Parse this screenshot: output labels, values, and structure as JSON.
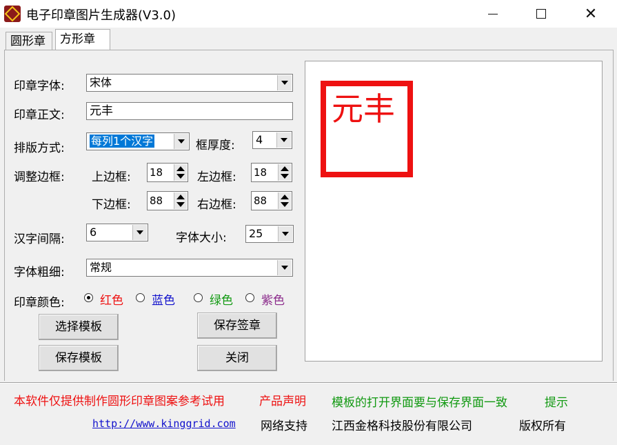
{
  "window": {
    "title": "电子印章图片生成器(V3.0)"
  },
  "tabs": [
    {
      "label": "圆形章"
    },
    {
      "label": "方形章"
    }
  ],
  "form": {
    "font_label": "印章字体:",
    "font_value": "宋体",
    "text_label": "印章正文:",
    "text_value": "元丰",
    "layout_label": "排版方式:",
    "layout_value": "每列1个汉字",
    "frame_thickness_label": "框厚度:",
    "frame_thickness_value": "4",
    "adjust_border_label": "调整边框:",
    "top_border_label": "上边框:",
    "top_border_value": "18",
    "left_border_label": "左边框:",
    "left_border_value": "18",
    "bottom_border_label": "下边框:",
    "bottom_border_value": "88",
    "right_border_label": "右边框:",
    "right_border_value": "88",
    "char_spacing_label": "汉字间隔:",
    "char_spacing_value": "6",
    "font_size_label": "字体大小:",
    "font_size_value": "25",
    "font_weight_label": "字体粗细:",
    "font_weight_value": "常规",
    "color_label": "印章颜色:",
    "colors": [
      {
        "label": "红色",
        "color": "#ee1111",
        "selected": true
      },
      {
        "label": "蓝色",
        "color": "#1111cc",
        "selected": false
      },
      {
        "label": "绿色",
        "color": "#119911",
        "selected": false
      },
      {
        "label": "紫色",
        "color": "#8b2b8b",
        "selected": false
      }
    ]
  },
  "buttons": {
    "select_template": "选择模板",
    "save_template": "保存模板",
    "save_seal": "保存签章",
    "close": "关闭"
  },
  "preview": {
    "stamp_text": "元丰",
    "stamp_color": "#ee1111"
  },
  "footer": {
    "disclaimer": "本软件仅提供制作圆形印章图案参考试用",
    "product_statement": "产品声明",
    "template_note": "模板的打开界面要与保存界面一致",
    "hint": "提示",
    "website": "http://www.kinggrid.com",
    "network_support": "网络支持",
    "company": "江西金格科技股份有限公司",
    "copyright": "版权所有"
  }
}
